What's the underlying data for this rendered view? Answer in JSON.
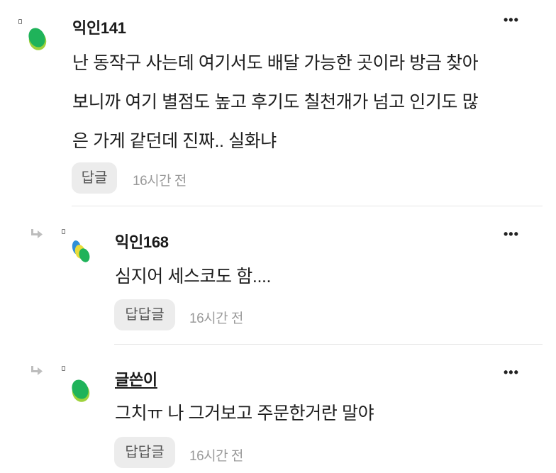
{
  "comments": [
    {
      "author": "익인141",
      "lines": [
        "난 동작구 사는데 여기서도 배달 가능한 곳이라 방금 찾아",
        "보니까 여기 별점도 높고 후기도 칠천개가 넘고 인기도 많",
        "은 가게 같던데 진짜.. 실화냐"
      ],
      "reply_label": "답글",
      "time": "16시간 전",
      "more": "•••"
    },
    {
      "author": "익인168",
      "lines": [
        "심지어 세스코도 함...."
      ],
      "reply_label": "답답글",
      "time": "16시간 전",
      "more": "•••"
    },
    {
      "author": "글쓴이",
      "lines": [
        "그치ㅠ 나 그거보고 주문한거란 말야"
      ],
      "reply_label": "답답글",
      "time": "16시간 전",
      "more": "•••"
    }
  ],
  "colors": {
    "avatar_green": "#1fb35a",
    "avatar_lightgreen": "#9ed23b",
    "avatar_blue": "#2f8fd8",
    "avatar_yellow": "#e9dc3a",
    "reply_button_bg": "#ececec",
    "time_text": "#9a9a9a"
  },
  "icons": [
    "collapse-square-icon",
    "reply-arrow-icon",
    "more-options-icon"
  ]
}
